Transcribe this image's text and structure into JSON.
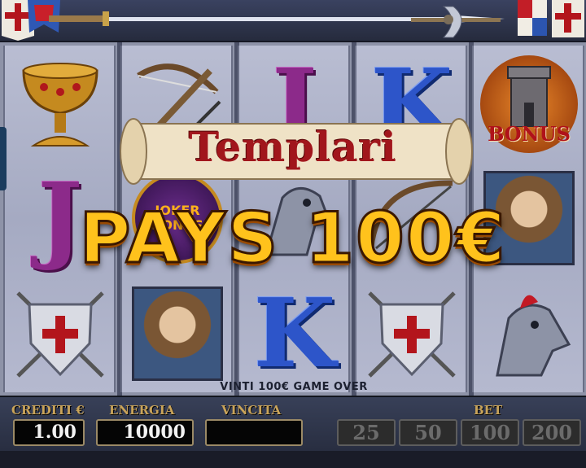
{
  "game": {
    "title": "Templari",
    "win_banner": "PAYS 100€",
    "status_message": "VINTI 100€  GAME OVER"
  },
  "reels": [
    [
      "grail-symbol",
      "letter-j-symbol",
      "shield-symbol"
    ],
    [
      "crossbow-symbol",
      "joker-bonus-symbol",
      "knight-portrait-symbol"
    ],
    [
      "letter-j-symbol",
      "armored-horse-symbol",
      "letter-k-symbol"
    ],
    [
      "letter-k-symbol",
      "bow-arrows-symbol",
      "shield-symbol"
    ],
    [
      "tower-bonus-symbol",
      "knight-portrait-symbol",
      "armored-horse-symbol"
    ]
  ],
  "symbols": {
    "letter_j": "J",
    "letter_k": "K",
    "bonus_label": "BONUS",
    "joker_label": "JOKER BONUS"
  },
  "panel": {
    "credits_label": "CREDITI €",
    "credits_value": "1.00",
    "energy_label": "ENERGIA",
    "energy_value": "10000",
    "win_label": "VINCITA",
    "win_value": "",
    "bet_label": "BET",
    "bet_options": [
      "25",
      "50",
      "100",
      "200"
    ]
  },
  "colors": {
    "win_text": "#ffc21c",
    "title_text": "#a1161c",
    "panel_label": "#c9a45a"
  }
}
